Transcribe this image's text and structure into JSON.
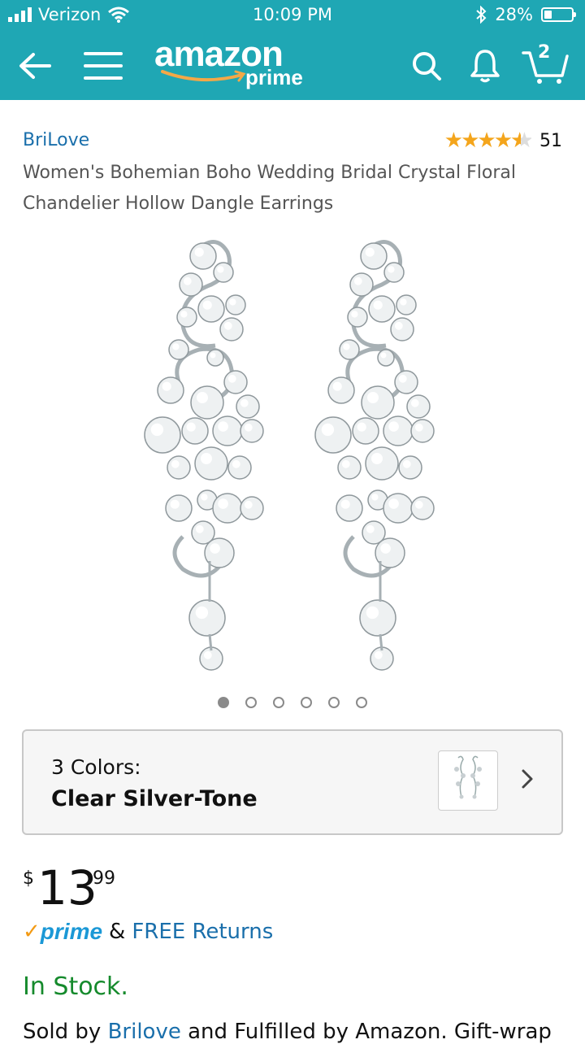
{
  "status_bar": {
    "carrier": "Verizon",
    "time": "10:09 PM",
    "battery": "28%",
    "battery_level": 0.28
  },
  "nav": {
    "logo_word": "amazon",
    "logo_prime": "prime",
    "cart_count": "2",
    "icons": [
      "back-arrow-icon",
      "menu-icon",
      "search-icon",
      "bell-icon",
      "cart-icon"
    ]
  },
  "product": {
    "brand": "BriLove",
    "rating_stars": 4.5,
    "rating_count": "51",
    "title": "Women's Bohemian Boho Wedding Bridal Crystal Floral Chandelier Hollow Dangle Earrings",
    "image_count": 6,
    "active_image": 0
  },
  "colors": {
    "count_label": "3 Colors:",
    "selected": "Clear Silver-Tone"
  },
  "price": {
    "currency": "$",
    "whole": "13",
    "fraction": "99"
  },
  "shipping": {
    "prime_check": "✓",
    "prime_label": "prime",
    "ampersand": "&",
    "returns": "FREE Returns"
  },
  "availability": "In Stock.",
  "seller": {
    "prefix": "Sold by",
    "name": "Brilove",
    "suffix": "and Fulfilled by Amazon. Gift-wrap"
  },
  "theme": {
    "header_color": "#1fa7b4",
    "link_color": "#1a6fab",
    "star_color": "#f4a51c",
    "stock_color": "#158a2c",
    "prime_color": "#1b98d6"
  }
}
